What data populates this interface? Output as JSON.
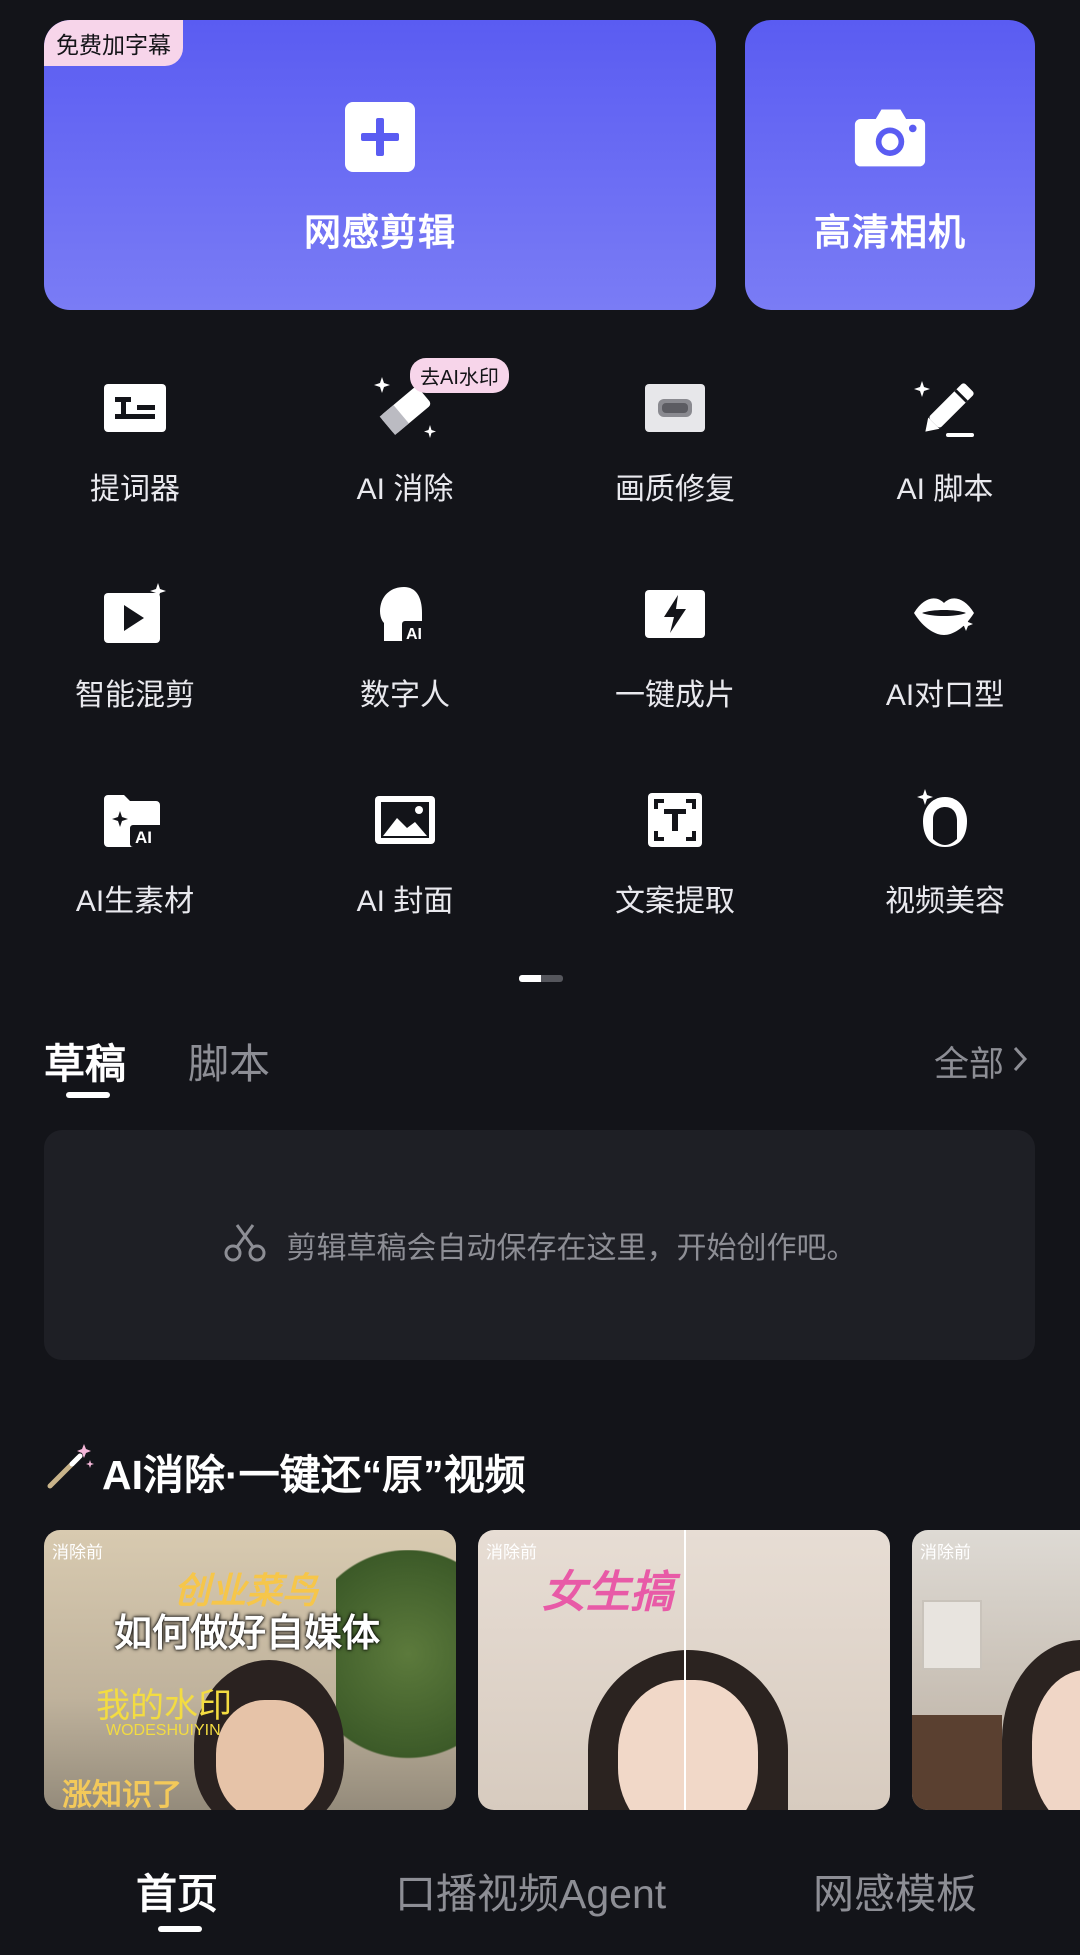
{
  "top_cards": {
    "edit": {
      "label": "网感剪辑",
      "badge": "免费加字幕",
      "icon": "plus-square-icon"
    },
    "camera": {
      "label": "高清相机",
      "icon": "camera-icon"
    }
  },
  "tools": [
    {
      "label": "提词器",
      "icon": "teleprompter-icon"
    },
    {
      "label": "AI 消除",
      "icon": "eraser-sparkle-icon",
      "badge": "去AI水印"
    },
    {
      "label": "画质修复",
      "icon": "hd-icon"
    },
    {
      "label": "AI 脚本",
      "icon": "pen-sparkle-icon"
    },
    {
      "label": "智能混剪",
      "icon": "video-sparkle-icon"
    },
    {
      "label": "数字人",
      "icon": "digital-human-icon"
    },
    {
      "label": "一键成片",
      "icon": "lightning-icon"
    },
    {
      "label": "AI对口型",
      "icon": "lips-icon"
    },
    {
      "label": "AI生素材",
      "icon": "folder-ai-icon"
    },
    {
      "label": "AI 封面",
      "icon": "image-icon"
    },
    {
      "label": "文案提取",
      "icon": "text-extract-icon"
    },
    {
      "label": "视频美容",
      "icon": "beauty-icon"
    }
  ],
  "tabs": {
    "drafts": "草稿",
    "script": "脚本",
    "all": "全部"
  },
  "draft_empty": "剪辑草稿会自动保存在这里，开始创作吧。",
  "ai_section": {
    "title": "AI消除·一键还“原”视频",
    "thumbs": [
      {
        "tag": "消除前",
        "line1": "创业菜鸟",
        "line2": "如何做好自媒体",
        "wm1": "我的水印",
        "wm2": "WODESHUIYIN",
        "bottom": "涨知识了"
      },
      {
        "tag": "消除前",
        "text": "女生搞"
      },
      {
        "tag": "消除前"
      }
    ]
  },
  "bottom_nav": {
    "home": "首页",
    "agent": "口播视频Agent",
    "template": "网感模板"
  },
  "colors": {
    "background": "#131419",
    "card_gradient_top": "#5a5cf2",
    "badge_bg": "#f7d5ea",
    "muted_text": "#8d8e95"
  }
}
